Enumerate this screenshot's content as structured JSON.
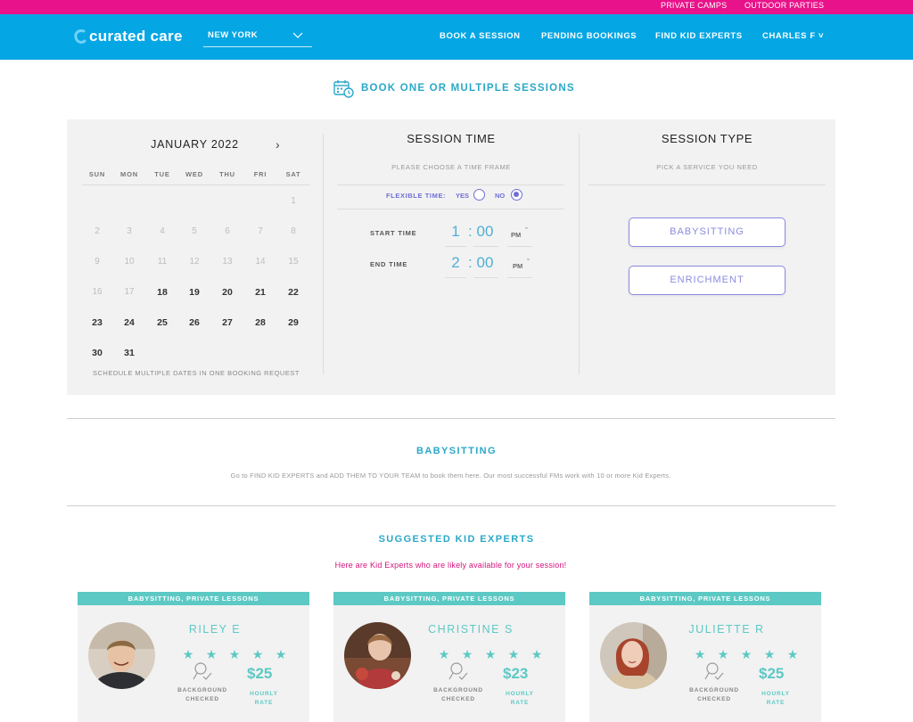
{
  "topbar": {
    "link1": "PRIVATE CAMPS",
    "link2": "OUTDOOR PARTIES"
  },
  "nav": {
    "logo": "curated care",
    "city": "NEW YORK",
    "links": [
      "BOOK A SESSION",
      "PENDING BOOKINGS",
      "FIND KID EXPERTS",
      "CHARLES F"
    ],
    "user_chevron": "˅"
  },
  "heading": "BOOK ONE OR MULTIPLE SESSIONS",
  "calendar": {
    "title": "JANUARY 2022",
    "next": "›",
    "weekdays": [
      "SUN",
      "MON",
      "TUE",
      "WED",
      "THU",
      "FRI",
      "SAT"
    ],
    "note": "SCHEDULE MULTIPLE DATES IN ONE BOOKING REQUEST"
  },
  "session_time": {
    "title": "SESSION TIME",
    "subtitle": "PLEASE CHOOSE A TIME FRAME",
    "flexible_label": "FLEXIBLE TIME:",
    "yes": "YES",
    "no": "NO",
    "flexible_selected": "NO",
    "start": {
      "label": "START TIME",
      "hour": "1",
      "colon": ":",
      "minute": "00",
      "ampm": "PM"
    },
    "end": {
      "label": "END TIME",
      "hour": "2",
      "colon": ":",
      "minute": "00",
      "ampm": "PM"
    }
  },
  "session_type": {
    "title": "SESSION TYPE",
    "subtitle": "PICK A SERVICE YOU NEED",
    "options": [
      "BABYSITTING",
      "ENRICHMENT"
    ]
  },
  "babysitting": {
    "title": "BABYSITTING",
    "text": "Go to FIND KID EXPERTS and ADD THEM TO YOUR TEAM to book them here. Our most successful FMs work with 10 or more Kid Experts."
  },
  "suggested": {
    "title": "SUGGESTED KID EXPERTS",
    "subtitle": "Here are Kid Experts who are likely available for your session!"
  },
  "experts": [
    {
      "tag": "BABYSITTING, PRIVATE LESSONS",
      "name": "RILEY E",
      "rating": 5,
      "bg_line1": "BACKGROUND",
      "bg_line2": "CHECKED",
      "rate": "$25",
      "rate_line1": "HOURLY",
      "rate_line2": "RATE"
    },
    {
      "tag": "BABYSITTING, PRIVATE LESSONS",
      "name": "CHRISTINE S",
      "rating": 5,
      "bg_line1": "BACKGROUND",
      "bg_line2": "CHECKED",
      "rate": "$23",
      "rate_line1": "HOURLY",
      "rate_line2": "RATE"
    },
    {
      "tag": "BABYSITTING, PRIVATE LESSONS",
      "name": "JULIETTE R",
      "rating": 5,
      "bg_line1": "BACKGROUND",
      "bg_line2": "CHECKED",
      "rate": "$25",
      "rate_line1": "HOURLY",
      "rate_line2": "RATE"
    }
  ],
  "colors": {
    "topbar": "#e8128a",
    "nav": "#05a6e4",
    "accent_teal": "#5cc9c4",
    "accent_purple": "#6f6fd6",
    "heading_blue": "#2aa8c8",
    "pink_text": "#d2157c"
  }
}
